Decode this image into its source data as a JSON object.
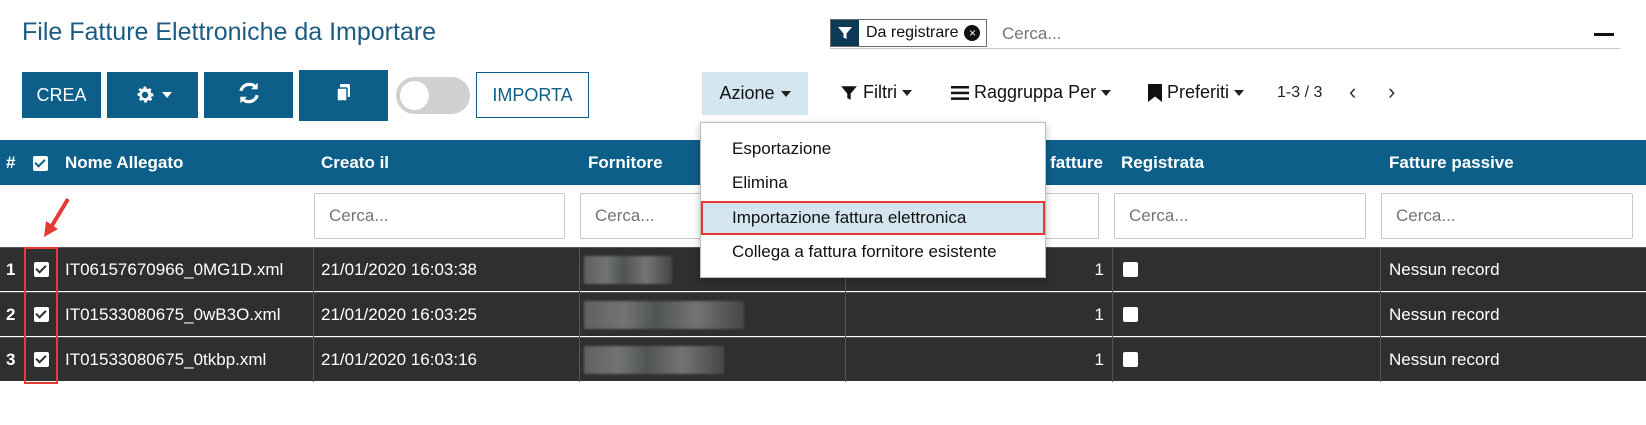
{
  "page": {
    "title": "File Fatture Elettroniche da Importare"
  },
  "search": {
    "facet_label": "Da registrare",
    "placeholder": "Cerca..."
  },
  "toolbar": {
    "crea_label": "CREA",
    "importa_label": "IMPORTA",
    "azione_label": "Azione",
    "filtri_label": "Filtri",
    "raggruppa_label": "Raggruppa Per",
    "preferiti_label": "Preferiti",
    "pager_text": "1-3 / 3"
  },
  "action_menu": {
    "items": [
      {
        "label": "Esportazione"
      },
      {
        "label": "Elimina"
      },
      {
        "label": "Importazione fattura elettronica",
        "active": true
      },
      {
        "label": "Collega a fattura fornitore esistente"
      }
    ]
  },
  "table": {
    "columns": {
      "num": "#",
      "nome": "Nome Allegato",
      "creato": "Creato il",
      "fornitore": "Fornitore",
      "n_fatture": "o fatture",
      "registrata": "Registrata",
      "passive": "Fatture passive"
    },
    "filter_placeholder": "Cerca...",
    "rows": [
      {
        "num": "1",
        "nome": "IT06157670966_0MG1D.xml",
        "creato": "21/01/2020 16:03:38",
        "count": "1",
        "passive": "Nessun record"
      },
      {
        "num": "2",
        "nome": "IT01533080675_0wB3O.xml",
        "creato": "21/01/2020 16:03:25",
        "count": "1",
        "passive": "Nessun record"
      },
      {
        "num": "3",
        "nome": "IT01533080675_0tkbp.xml",
        "creato": "21/01/2020 16:03:16",
        "count": "1",
        "passive": "Nessun record"
      }
    ]
  },
  "colors": {
    "primary": "#0d5f8a",
    "header_bg": "#0d5f8a",
    "row_bg": "#2f2f2f",
    "highlight": "#e53935",
    "title": "#1c5b82"
  }
}
